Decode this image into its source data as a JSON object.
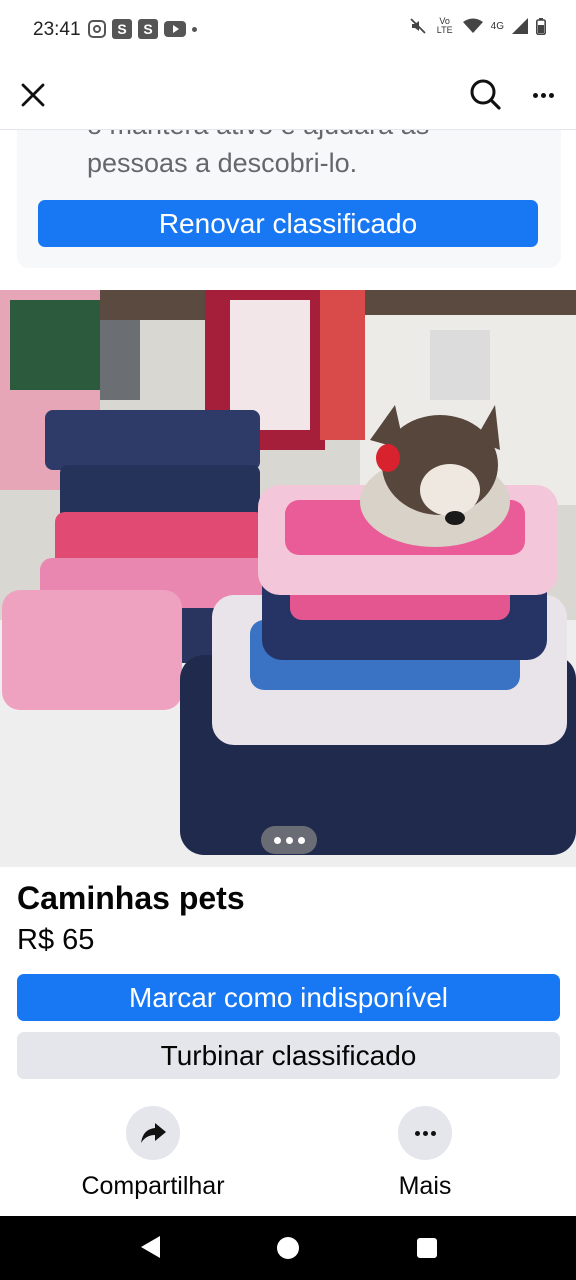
{
  "status_bar": {
    "time": "23:41",
    "app_icon_s1": "S",
    "app_icon_s2": "S",
    "network_label": "4G",
    "volte_label": "Vo LTE",
    "icons": [
      "instagram-icon",
      "youtube-icon",
      "mute-icon",
      "wifi-icon",
      "signal-icon",
      "battery-icon"
    ]
  },
  "app_bar": {
    "icons": [
      "close-icon",
      "search-icon",
      "more-icon"
    ]
  },
  "renew_card": {
    "text_partial": "o manterá ativo e ajudará as",
    "text_line2": "pessoas a descobri-lo.",
    "button_label": "Renovar classificado"
  },
  "photo": {
    "pager_dots": 3
  },
  "listing": {
    "title": "Caminhas pets",
    "price": "R$ 65"
  },
  "buttons": {
    "mark_unavailable": "Marcar como indisponível",
    "boost": "Turbinar classificado"
  },
  "actions": {
    "share_label": "Compartilhar",
    "more_label": "Mais"
  },
  "colors": {
    "primary": "#1877f2",
    "secondary_bg": "#e4e6eb",
    "muted_text": "#65676b"
  }
}
